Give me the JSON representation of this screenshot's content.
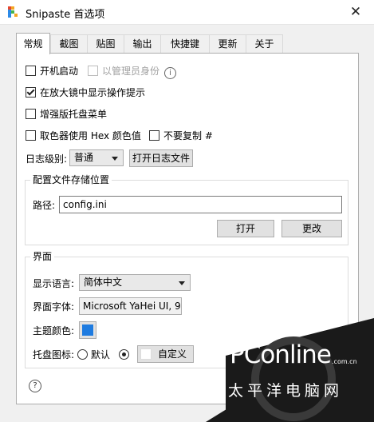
{
  "window": {
    "title": "Snipaste 首选项",
    "close_glyph": "✕"
  },
  "tabs": [
    {
      "label": "常规",
      "active": true
    },
    {
      "label": "截图"
    },
    {
      "label": "贴图"
    },
    {
      "label": "输出"
    },
    {
      "label": "快捷键"
    },
    {
      "label": "更新"
    },
    {
      "label": "关于"
    }
  ],
  "general": {
    "startup": {
      "label": "开机启动",
      "checked": false
    },
    "run_as_admin": {
      "label": "以管理员身份",
      "checked": false,
      "disabled": true
    },
    "magnifier_tips": {
      "label": "在放大镜中显示操作提示",
      "checked": true
    },
    "enhanced_tray": {
      "label": "增强版托盘菜单",
      "checked": false
    },
    "hex_color": {
      "label": "取色器使用 Hex 颜色值",
      "checked": false
    },
    "no_copy_hash": {
      "label": "不要复制 #",
      "checked": false
    },
    "log_level": {
      "label": "日志级别:",
      "value": "普通"
    },
    "open_log_button": "打开日志文件"
  },
  "config": {
    "group_title": "配置文件存储位置",
    "path_label": "路径:",
    "path_value": "config.ini",
    "open_button": "打开",
    "change_button": "更改"
  },
  "interface": {
    "group_title": "界面",
    "language_label": "显示语言:",
    "language_value": "简体中文",
    "font_label": "界面字体:",
    "font_value": "Microsoft YaHei UI, 9",
    "theme_label": "主题颜色:",
    "theme_color": "#1e7be0",
    "tray_icon_label": "托盘图标:",
    "tray_default_label": "默认",
    "tray_default_checked": false,
    "tray_custom_checked": true,
    "tray_custom_button": "自定义"
  },
  "help_glyph": "?",
  "watermark": {
    "main": "PConline",
    "domain": ".com.cn",
    "cn": "太平洋电脑网"
  }
}
